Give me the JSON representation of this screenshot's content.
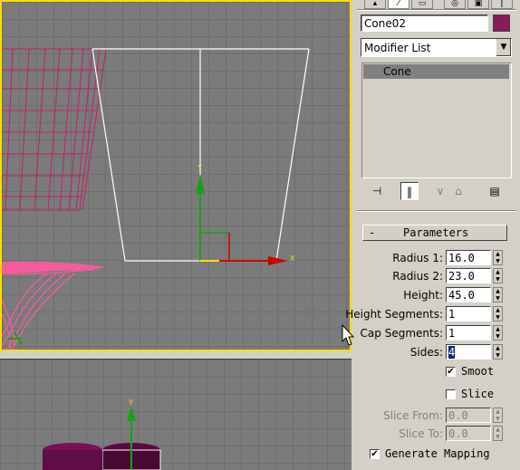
{
  "colors": {
    "accent_viewport_border": "#ffdc00",
    "object_color": "#8b1a5a",
    "selected_wire": "#ffffff",
    "other_wire": "#c0206a"
  },
  "command_panel": {
    "tabs": [
      "create-icon",
      "modify-icon",
      "hierarchy-icon",
      "motion-icon",
      "display-icon",
      "utilities-icon"
    ],
    "object_name": "Cone02",
    "modifier_list_label": "Modifier List",
    "stack_items": [
      "Cone"
    ],
    "stack_tools": [
      "pin-stack-icon",
      "show-end-result-icon",
      "make-unique-icon",
      "remove-modifier-icon",
      "configure-sets-icon"
    ]
  },
  "parameters": {
    "rollout_toggle": "-",
    "rollout_title": "Parameters",
    "radius1_label": "Radius 1:",
    "radius1_value": "16.0",
    "radius2_label": "Radius 2:",
    "radius2_value": "23.0",
    "height_label": "Height:",
    "height_value": "45.0",
    "height_segments_label": "Height Segments:",
    "height_segments_value": "1",
    "cap_segments_label": "Cap Segments:",
    "cap_segments_value": "1",
    "sides_label": "Sides:",
    "sides_value": "4",
    "smooth_label": "Smoot",
    "smooth_checked": true,
    "slice_label": "Slice",
    "slice_checked": false,
    "slice_from_label": "Slice From:",
    "slice_from_value": "0.0",
    "slice_to_label": "Slice To:",
    "slice_to_value": "0.0",
    "generate_mapping_label": "Generate Mapping",
    "generate_mapping_checked": true
  },
  "viewport": {
    "axis_y_label": "Y",
    "axis_x_label": "X"
  }
}
